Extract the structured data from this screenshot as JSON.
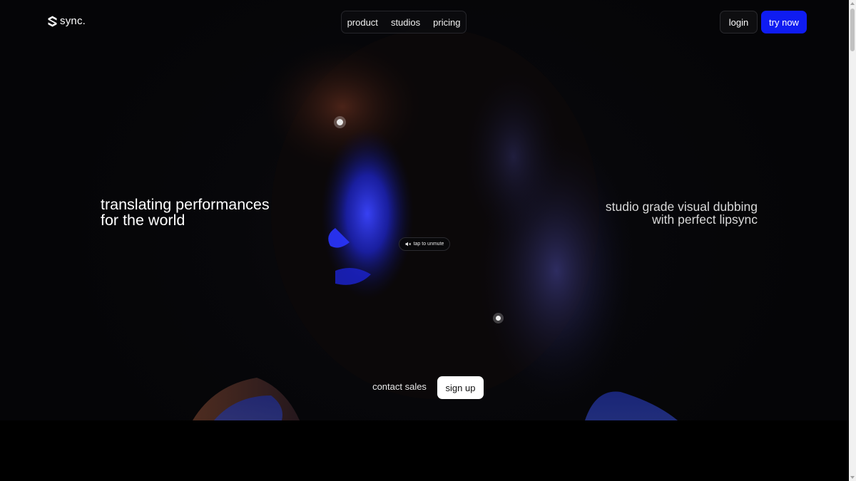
{
  "brand": {
    "name": "sync.",
    "icon": "sync-logo-icon"
  },
  "nav": {
    "items": [
      "product",
      "studios",
      "pricing"
    ]
  },
  "auth": {
    "login_label": "login",
    "try_label": "try now"
  },
  "hero": {
    "headline_left": [
      "translating performances",
      "for the world"
    ],
    "headline_right": [
      "studio grade visual dubbing",
      "with perfect lipsync"
    ],
    "unmute_label": "tap to unmute",
    "unmute_icon": "speaker-muted-icon"
  },
  "cta": {
    "contact_label": "contact sales",
    "signup_label": "sign up"
  },
  "colors": {
    "accent": "#0f1cf2",
    "background": "#050507",
    "highlight_blue": "#2230ff"
  }
}
